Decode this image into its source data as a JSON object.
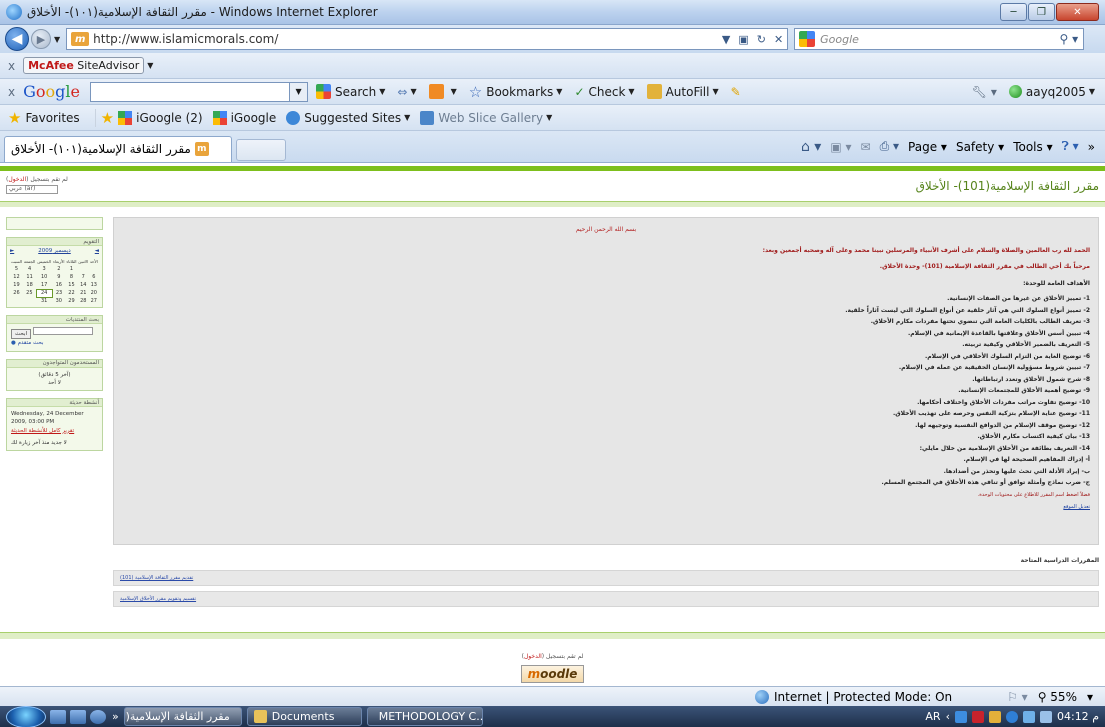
{
  "window": {
    "title": "مقرر الثقافة الإسلامية(١٠١)- الأخلاق - Windows Internet Explorer",
    "buttons": {
      "minimize": "─",
      "maximize": "❐",
      "close": "✕"
    }
  },
  "address_bar": {
    "url": "http://www.islamicmorals.com/",
    "search_placeholder": "Google"
  },
  "mcafee_bar": {
    "close": "x",
    "label_brand": "McAfee",
    "label_rest": " SiteAdvisor"
  },
  "google_toolbar": {
    "close": "x",
    "logo": [
      "G",
      "o",
      "o",
      "g",
      "l",
      "e"
    ],
    "search_label": "Search",
    "bookmarks_label": "Bookmarks",
    "check_label": "Check",
    "autofill_label": "AutoFill",
    "user": "aayq2005"
  },
  "favorites_bar": {
    "favorites_label": "Favorites",
    "items": [
      "iGoogle (2)",
      "iGoogle",
      "Suggested Sites",
      "Web Slice Gallery"
    ]
  },
  "tab": {
    "title": "مقرر الثقافة الإسلامية(١٠١)- الأخلاق"
  },
  "command_bar": {
    "page_label": "Page",
    "safety_label": "Safety",
    "tools_label": "Tools",
    "overflow": "»"
  },
  "page": {
    "site_title": "مقرر الثقافة الإسلامية(101)- الأخلاق",
    "lang_text": "لم تقم بتسجيل",
    "lang_link": "الدخول",
    "lang_select": "عربي (ar)",
    "calendar": {
      "header": "التقويم",
      "prev": "►",
      "month": "ديسمبر 2009",
      "next": "◄",
      "days": [
        "الأحد",
        "الاثنين",
        "الثلاثاء",
        "الأربعاء",
        "الخميس",
        "الجمعة",
        "السبت"
      ],
      "weeks": [
        [
          "",
          "",
          "1",
          "2",
          "3",
          "4",
          "5"
        ],
        [
          "6",
          "7",
          "8",
          "9",
          "10",
          "11",
          "12"
        ],
        [
          "13",
          "14",
          "15",
          "16",
          "17",
          "18",
          "19"
        ],
        [
          "20",
          "21",
          "22",
          "23",
          "24",
          "25",
          "26"
        ],
        [
          "27",
          "28",
          "29",
          "30",
          "31",
          "",
          ""
        ]
      ],
      "today": "24"
    },
    "search_block": {
      "header": "بحث المنتديات",
      "button": "ابحث",
      "advanced": "بحث متقدم"
    },
    "online_users": {
      "header": "المستخدمون المتواجدون",
      "body": "(آخر 5 دقائق)",
      "none": "لا أحد"
    },
    "activity": {
      "header": "أنشطة حديثة",
      "timestamp": "Wednesday, 24 December 2009, 03:00 PM",
      "link": "تقرير كامل للأنشطة الحديثة",
      "note": "لا جديد منذ آخر زيارة لك"
    },
    "main": {
      "basmala": "بسم الله الرحمن الرحيم",
      "intro": "الحمد لله رب العالمين والصلاة والسلام على أشرف الأنبياء والمرسلين نبينا محمد وعلى آله وصحبه أجمعين وبعد:",
      "welcome": "مرحباً بك أخي الطالب في مقرر الثقافة الإسلامية (101)- وحدة الأخلاق.",
      "objectives_title": "الأهداف العامة للوحدة:",
      "objectives": [
        "1- تمييز الأخلاق عن غيرها من الصفات الإنسانية.",
        "2- تمييز أنواع السلوك التي هي آثار خلقية عن أنواع السلوك التي ليست آثاراً خلقية.",
        "3- تعريف الطالب بالكليات العامة التي تنضوي تحتها مفردات مكارم الأخلاق.",
        "4- تبيين أسس الأخلاق وعلاقتها بالقاعدة الإيمانية في الإسلام.",
        "5- التعريف بالضمير الأخلاقي وكيفية تربيته.",
        "6- توضيح الغاية من التزام السلوك الأخلاقي في الإسلام.",
        "7- تبيين شروط مسؤولية الإنسان الحقيقية عن عمله في الإسلام.",
        "8- شرح شمول الأخلاق وتعدد ارتباطاتها.",
        "9- توضيح أهمية الأخلاق للمجتمعات الإنسانية.",
        "10- توضيح تفاوت مراتب مفردات الأخلاق واختلاف أحكامها.",
        "11- توضيح عناية الإسلام بتزكية النفس وحرصه على تهذيب الأخلاق.",
        "12- توضيح موقف الإسلام من الدوافع النفسية وتوجيهه لها.",
        "13- بيان كيفية اكتساب مكارم الأخلاق.",
        "14- التعريف بطائفة من الأخلاق الإسلامية من خلال مايلي:",
        "أ- إدراك المفاهيم الصحيحة لها في الإسلام.",
        "ب- إيراد الأدلة التي تحث عليها وتحذر من أضدادها.",
        "ج- ضرب نماذج وأمثلة توافق أو تنافي هذه الأخلاق في المجتمع المسلم."
      ],
      "note": "فضلاً اضغط اسم المقرر للاطلاع على محتويات الوحدة.",
      "link": "تعديل الموقع"
    },
    "courses": {
      "title": "المقررات الدراسية المتاحة",
      "items": [
        "تقديم مقرر الثقافة الإسلامية (101)",
        "تقسيم وتقويم مقرر الأخلاق الإسلامية"
      ]
    },
    "footer": {
      "text": "لم تقم بتسجيل",
      "link": "الدخول",
      "logo_m": "m",
      "logo_rest": "oodle"
    }
  },
  "status_bar": {
    "zone": "Internet | Protected Mode: On",
    "zoom": "55%"
  },
  "taskbar": {
    "ie_task": "مقرر الثقافة الإسلامية(...",
    "documents_task": "Documents",
    "word_task": "METHODOLOGY C...",
    "lang": "AR",
    "time": "04:12 م"
  }
}
